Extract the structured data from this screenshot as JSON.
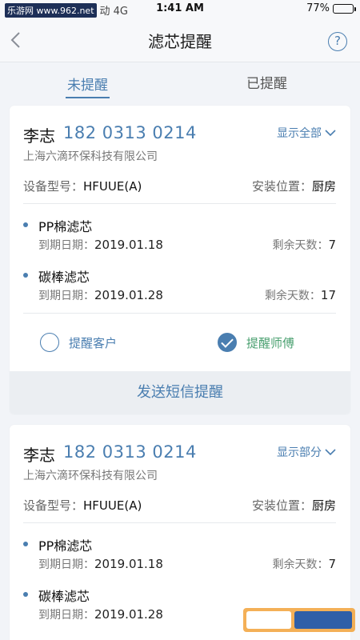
{
  "status_bar": {
    "watermark": "乐游网 www.962.net",
    "carrier": "动 4G",
    "time": "1:41 AM",
    "battery": "77%",
    "battery_level": 0.77
  },
  "nav": {
    "title": "滤芯提醒",
    "help_symbol": "?"
  },
  "tabs": [
    {
      "label": "未提醒",
      "active": true
    },
    {
      "label": "已提醒",
      "active": false
    }
  ],
  "cards": [
    {
      "name": "李志",
      "phone": "182 0313 0214",
      "toggle": "显示全部",
      "company": "上海六滴环保科技有限公司",
      "device_label": "设备型号：",
      "device_value": "HFUUE(A)",
      "location_label": "安装位置：",
      "location_value": "厨房",
      "filters": [
        {
          "name": "PP棉滤芯",
          "date_label": "到期日期：",
          "date": "2019.01.18",
          "days_label": "剩余天数：",
          "days": "7"
        },
        {
          "name": "碳棒滤芯",
          "date_label": "到期日期：",
          "date": "2019.01.28",
          "days_label": "剩余天数：",
          "days": "17"
        }
      ],
      "options": [
        {
          "label": "提醒客户",
          "checked": false
        },
        {
          "label": "提醒师傅",
          "checked": true
        }
      ],
      "send_button": "发送短信提醒"
    },
    {
      "name": "李志",
      "phone": "182 0313 0214",
      "toggle": "显示部分",
      "company": "上海六滴环保科技有限公司",
      "device_label": "设备型号：",
      "device_value": "HFUUE(A)",
      "location_label": "安装位置：",
      "location_value": "厨房",
      "filters": [
        {
          "name": "PP棉滤芯",
          "date_label": "到期日期：",
          "date": "2019.01.18",
          "days_label": "剩余天数：",
          "days": "7"
        },
        {
          "name": "碳棒滤芯",
          "date_label": "到期日期：",
          "date": "2019.01.28"
        }
      ]
    }
  ],
  "watermark_logo": "962.NET 乐游网",
  "colors": {
    "accent": "#4a7eb0",
    "check_green": "#4aa070",
    "background": "#f2f4f8"
  }
}
